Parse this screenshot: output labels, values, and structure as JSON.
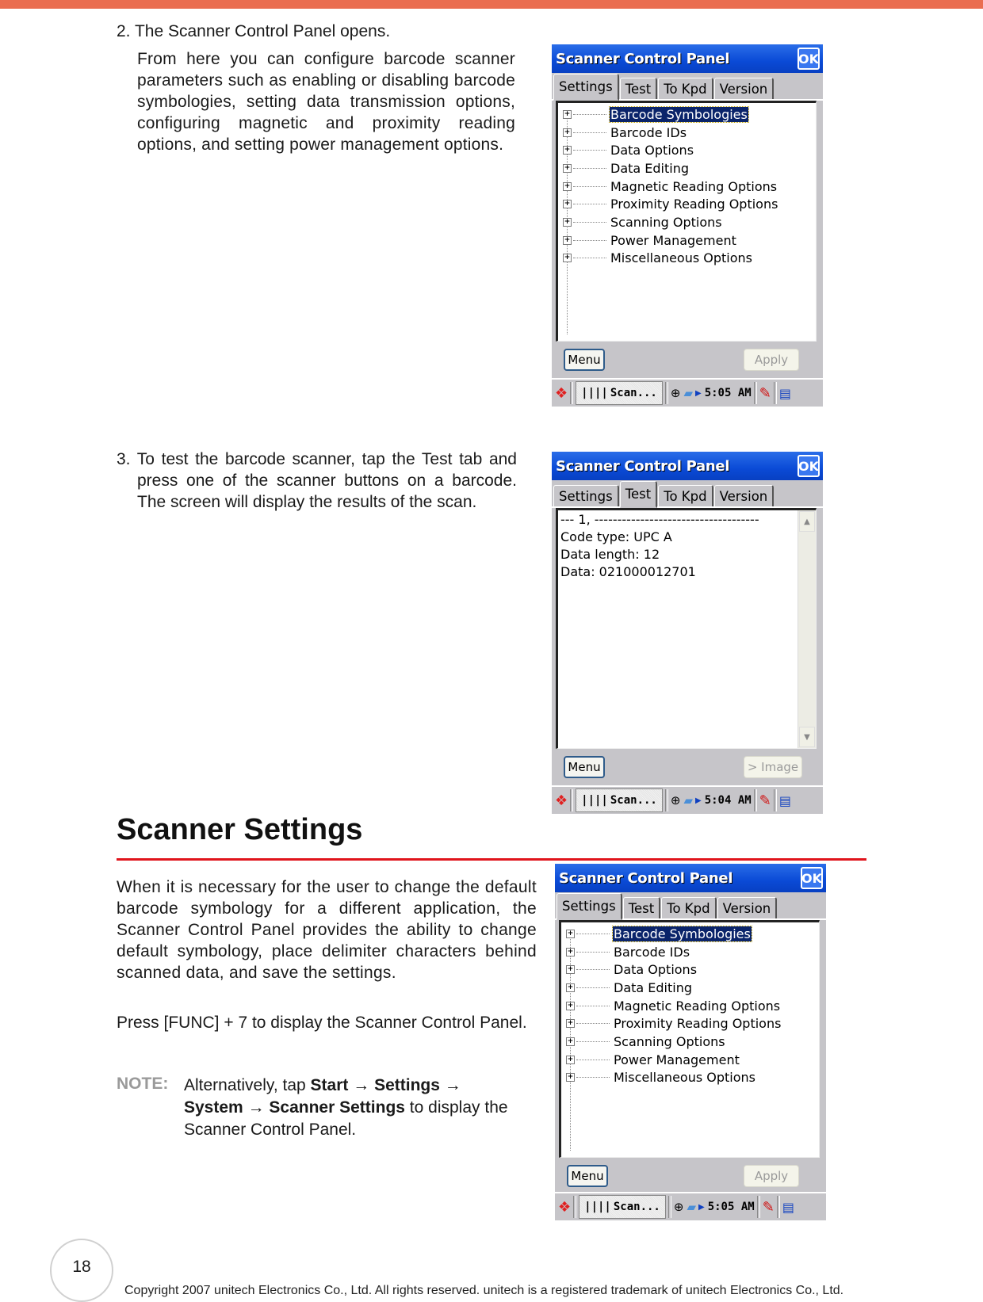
{
  "steps": [
    {
      "heading": "2. The Scanner Control Panel opens.",
      "body": "From here you can configure barcode scanner parameters such as enabling or disabling barcode symbologies, setting data transmission options, configuring magnetic and proximity reading options, and setting power management options."
    },
    {
      "heading": "3. To test the barcode scanner, tap the Test tab and press one of the scanner buttons on a barcode. The screen will display the results of the scan."
    }
  ],
  "section": {
    "title": "Scanner Settings",
    "paragraph1": "When it is necessary for the user to change the default barcode symbology for a different application, the Scanner Control Panel provides the ability to change default symbology, place delimiter characters behind scanned data, and save the settings.",
    "paragraph2": "Press [FUNC] + 7 to display the Scanner Control Panel.",
    "note_label": "NOTE:",
    "note": {
      "prefix": "Alternatively, tap ",
      "path": [
        "Start",
        "Settings",
        "System",
        "Scanner Settings"
      ],
      "arrow": "→",
      "suffix": " to display the Scanner Control Panel."
    }
  },
  "screens": {
    "title": "Scanner Control Panel",
    "ok_label": "OK",
    "tabs": [
      "Settings",
      "Test",
      "To Kpd",
      "Version"
    ],
    "tree_items": [
      "Barcode Symbologies",
      "Barcode IDs",
      "Data Options",
      "Data Editing",
      "Magnetic Reading Options",
      "Proximity Reading Options",
      "Scanning Options",
      "Power Management",
      "Miscellaneous Options"
    ],
    "menu_label": "Menu",
    "apply_label": "Apply",
    "image_label": "> Image",
    "task_label": "Scan...",
    "test_output": [
      "--- 1, ------------------------------------",
      "Code type: UPC A",
      "Data length: 12",
      "Data: 021000012701"
    ],
    "clock_a": "5:05 AM",
    "clock_b": "5:04 AM",
    "clock_c": "5:05 AM"
  },
  "footer": {
    "page_number": "18",
    "copyright": "Copyright 2007 unitech Electronics Co., Ltd. All rights reserved. unitech is a registered trademark of unitech Electronics Co., Ltd."
  },
  "colors": {
    "top_bar": "#ea6d50",
    "heading_rule": "#e0141c",
    "note_label": "#9a9a9a",
    "title_bar": "#0a4ad6",
    "selection": "#0a246a"
  }
}
